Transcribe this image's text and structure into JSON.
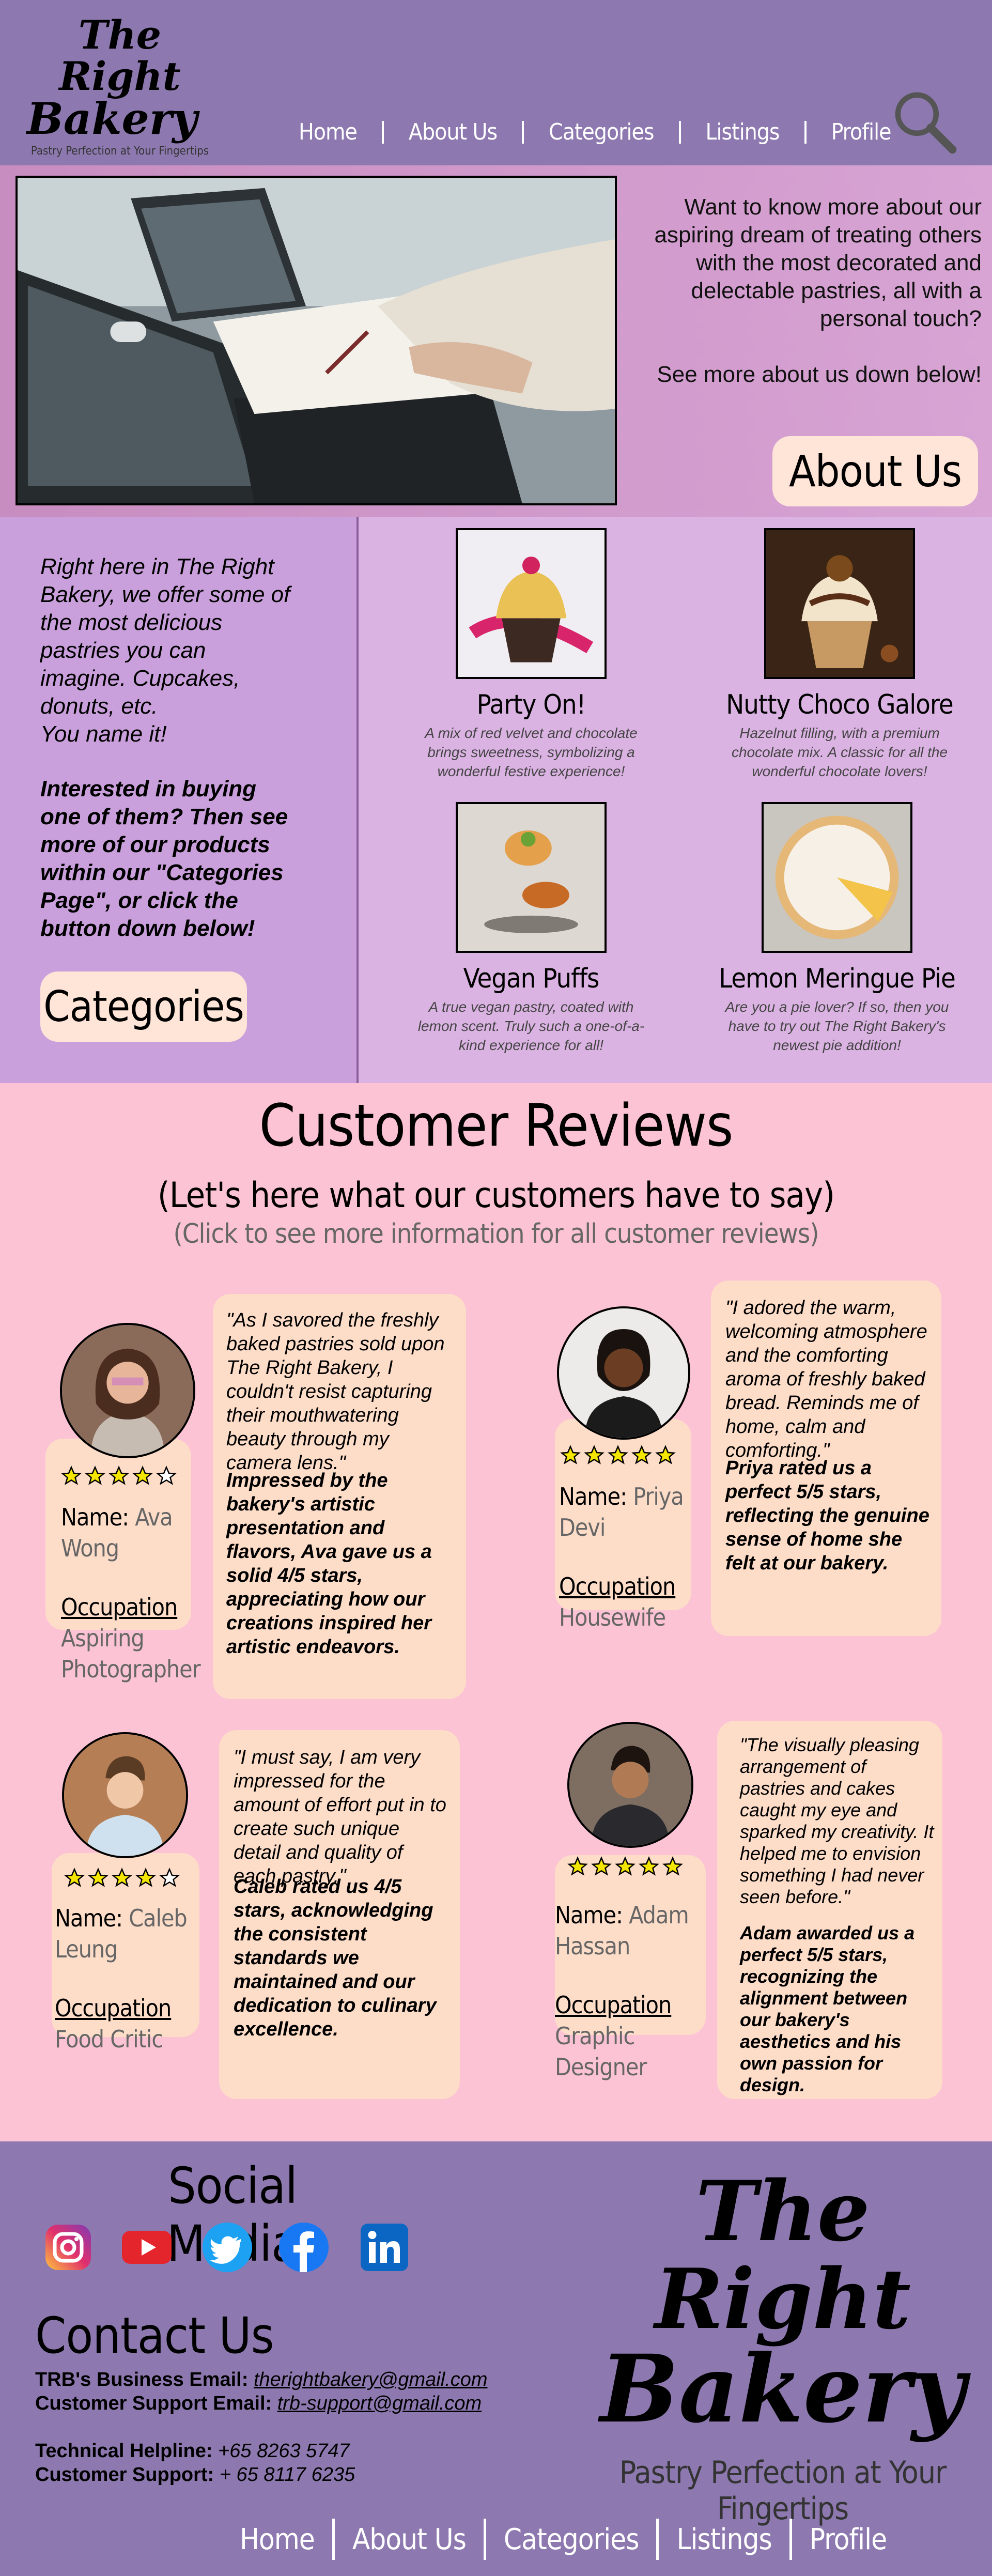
{
  "brand": {
    "name_line1": "The Right",
    "name_line2": "Bakery",
    "tagline": "Pastry Perfection at Your Fingertips"
  },
  "nav": {
    "items": [
      "Home",
      "About Us",
      "Categories",
      "Listings",
      "Profile"
    ]
  },
  "hero": {
    "text": "Want to know more about our aspiring dream of treating others with the most decorated and delectable pastries, all with a personal touch?",
    "text2": "See more about us down below!",
    "button": "About Us"
  },
  "products_section": {
    "intro": "Right here in The Right Bakery, we offer some of the most delicious pastries you can imagine. Cupcakes, donuts, etc.",
    "intro2": "You name it!",
    "cta": "Interested in buying one of them? Then see more of our products within our \"Categories Page\", or click the button down below!",
    "button": "Categories",
    "products": [
      {
        "name": "Party On!",
        "desc": "A mix of red velvet and chocolate brings sweetness, symbolizing a wonderful festive experience!"
      },
      {
        "name": "Nutty Choco Galore",
        "desc": "Hazelnut filling, with a premium chocolate mix. A classic for all the wonderful chocolate lovers!"
      },
      {
        "name": "Vegan Puffs",
        "desc": "A true vegan pastry, coated with lemon scent. Truly such a one-of-a-kind experience for all!"
      },
      {
        "name": "Lemon Meringue Pie",
        "desc": "Are you a pie lover? If so, then you have to try out The Right Bakery's newest pie addition!"
      }
    ]
  },
  "reviews_section": {
    "title": "Customer Reviews",
    "subtitle": "(Let's here what our customers have to say)",
    "subtitle2": "(Click to see more information for all customer reviews)",
    "name_label": "Name:",
    "occupation_label": "Occupation",
    "reviews": [
      {
        "name": "Ava Wong",
        "occupation": "Aspiring Photographer",
        "rating": 4,
        "quote": "\"As I savored the freshly baked pastries sold upon The Right Bakery, I couldn't resist capturing their mouthwatering beauty through my camera lens.\"",
        "summary": "Impressed by the bakery's artistic presentation and flavors, Ava gave us a solid 4/5 stars, appreciating how our creations inspired her artistic endeavors."
      },
      {
        "name": "Priya Devi",
        "occupation": "Housewife",
        "rating": 5,
        "quote": "\"I adored the warm, welcoming atmosphere and the comforting aroma of freshly baked bread. Reminds me of home, calm and comforting.\"",
        "summary": "Priya rated us a perfect 5/5 stars, reflecting the genuine sense of home she felt at our bakery."
      },
      {
        "name": "Caleb Leung",
        "occupation": "Food Critic",
        "rating": 4,
        "quote": "\"I must say, I am very impressed for the amount of effort put in to create such unique detail and quality of each pastry.\"",
        "summary": "Caleb rated us 4/5 stars, acknowledging the consistent standards we maintained and our dedication to culinary excellence."
      },
      {
        "name": "Adam Hassan",
        "occupation": "Graphic Designer",
        "rating": 5,
        "quote": "\"The visually pleasing arrangement of pastries and cakes caught my eye and sparked my creativity. It helped me to envision something I had never seen before.\"",
        "summary": "Adam awarded us a perfect 5/5 stars, recognizing the alignment between our bakery's aesthetics and his own passion for design."
      }
    ]
  },
  "footer": {
    "social_title": "Social Media",
    "social": [
      "instagram-icon",
      "youtube-icon",
      "twitter-icon",
      "facebook-icon",
      "linkedin-icon"
    ],
    "contact_title": "Contact Us",
    "business_email_label": "TRB's Business Email:",
    "business_email": "therightbakery@gmail.com",
    "support_email_label": "Customer Support Email:",
    "support_email": "trb-support@gmail.com",
    "helpline_label": "Technical Helpline:",
    "helpline": "+65 8263 5747",
    "support_label": "Customer Support:",
    "support_phone": "+ 65 8117 6235"
  },
  "colors": {
    "header_bg": "#8d79b0",
    "hero_bg": "#d7a4d4",
    "products_bg": "#dbb3e3",
    "reviews_bg": "#fcc3d5",
    "card_bg": "#fddcc8",
    "button_bg": "#ffe4d8",
    "star": "#f5e600"
  }
}
